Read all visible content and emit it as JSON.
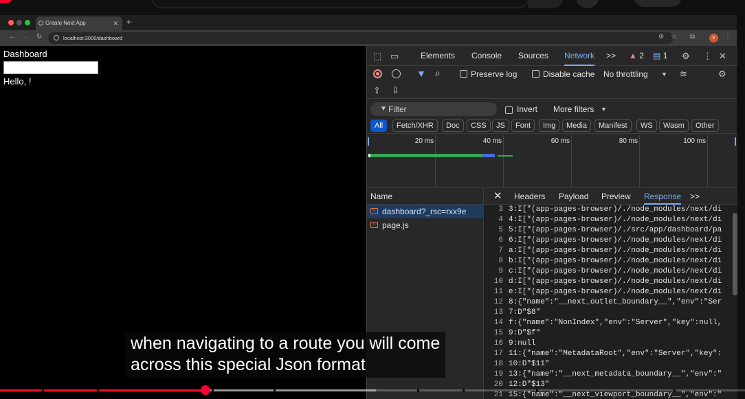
{
  "browser": {
    "tab_title": "Create Next App",
    "url": "localhost:3000/dashboard",
    "profile_initial": "V"
  },
  "page": {
    "title": "Dashboard",
    "input_value": "",
    "greeting": "Hello, !"
  },
  "devtools": {
    "tabs": [
      "Elements",
      "Console",
      "Sources",
      "Network"
    ],
    "active_tab": "Network",
    "more_tabs": ">>",
    "warning_count": "2",
    "message_count": "1",
    "toolbar": {
      "preserve_log": "Preserve log",
      "disable_cache": "Disable cache",
      "throttling": "No throttling"
    },
    "filter": {
      "placeholder": "Filter",
      "invert": "Invert",
      "more_filters": "More filters"
    },
    "type_filters": [
      "All",
      "Fetch/XHR",
      "Doc",
      "CSS",
      "JS",
      "Font",
      "Img",
      "Media",
      "Manifest",
      "WS",
      "Wasm",
      "Other"
    ],
    "active_type": "All",
    "overview_ticks": [
      "20 ms",
      "40 ms",
      "60 ms",
      "80 ms",
      "100 ms"
    ],
    "requests_header": "Name",
    "requests": [
      {
        "name": "dashboard?_rsc=rxx9e",
        "selected": true
      },
      {
        "name": "page.js",
        "selected": false
      }
    ],
    "detail_tabs": [
      "Headers",
      "Payload",
      "Preview",
      "Response"
    ],
    "active_detail_tab": "Response",
    "response_lines": [
      {
        "n": "3",
        "t": "3:I[\"(app-pages-browser)/./node_modules/next/di"
      },
      {
        "n": "4",
        "t": "4:I[\"(app-pages-browser)/./node_modules/next/di"
      },
      {
        "n": "5",
        "t": "5:I[\"(app-pages-browser)/./src/app/dashboard/pa"
      },
      {
        "n": "6",
        "t": "6:I[\"(app-pages-browser)/./node_modules/next/di"
      },
      {
        "n": "7",
        "t": "a:I[\"(app-pages-browser)/./node_modules/next/di"
      },
      {
        "n": "8",
        "t": "b:I[\"(app-pages-browser)/./node_modules/next/di"
      },
      {
        "n": "9",
        "t": "c:I[\"(app-pages-browser)/./node_modules/next/di"
      },
      {
        "n": "10",
        "t": "d:I[\"(app-pages-browser)/./node_modules/next/di"
      },
      {
        "n": "11",
        "t": "e:I[\"(app-pages-browser)/./node_modules/next/di"
      },
      {
        "n": "12",
        "t": "8:{\"name\":\"__next_outlet_boundary__\",\"env\":\"Ser"
      },
      {
        "n": "13",
        "t": "7:D\"$8\""
      },
      {
        "n": "14",
        "t": "f:{\"name\":\"NonIndex\",\"env\":\"Server\",\"key\":null,"
      },
      {
        "n": "15",
        "t": "9:D\"$f\""
      },
      {
        "n": "16",
        "t": "9:null"
      },
      {
        "n": "17",
        "t": "11:{\"name\":\"MetadataRoot\",\"env\":\"Server\",\"key\":"
      },
      {
        "n": "18",
        "t": "10:D\"$11\""
      },
      {
        "n": "19",
        "t": "13:{\"name\":\"__next_metadata_boundary__\",\"env\":\""
      },
      {
        "n": "20",
        "t": "12:D\"$13\""
      },
      {
        "n": "21",
        "t": "15:{\"name\":\"__next_viewport_boundary__\",\"env\":\""
      }
    ]
  },
  "video": {
    "caption_lines": [
      "when navigating to a route you will come",
      "across this special Json format"
    ],
    "progress_fraction": 0.276,
    "buffered_fraction": 0.505
  },
  "colors": {
    "accent_blue": "#7cacf8",
    "record_red": "#f28b82",
    "youtube_red": "#ff0033"
  }
}
